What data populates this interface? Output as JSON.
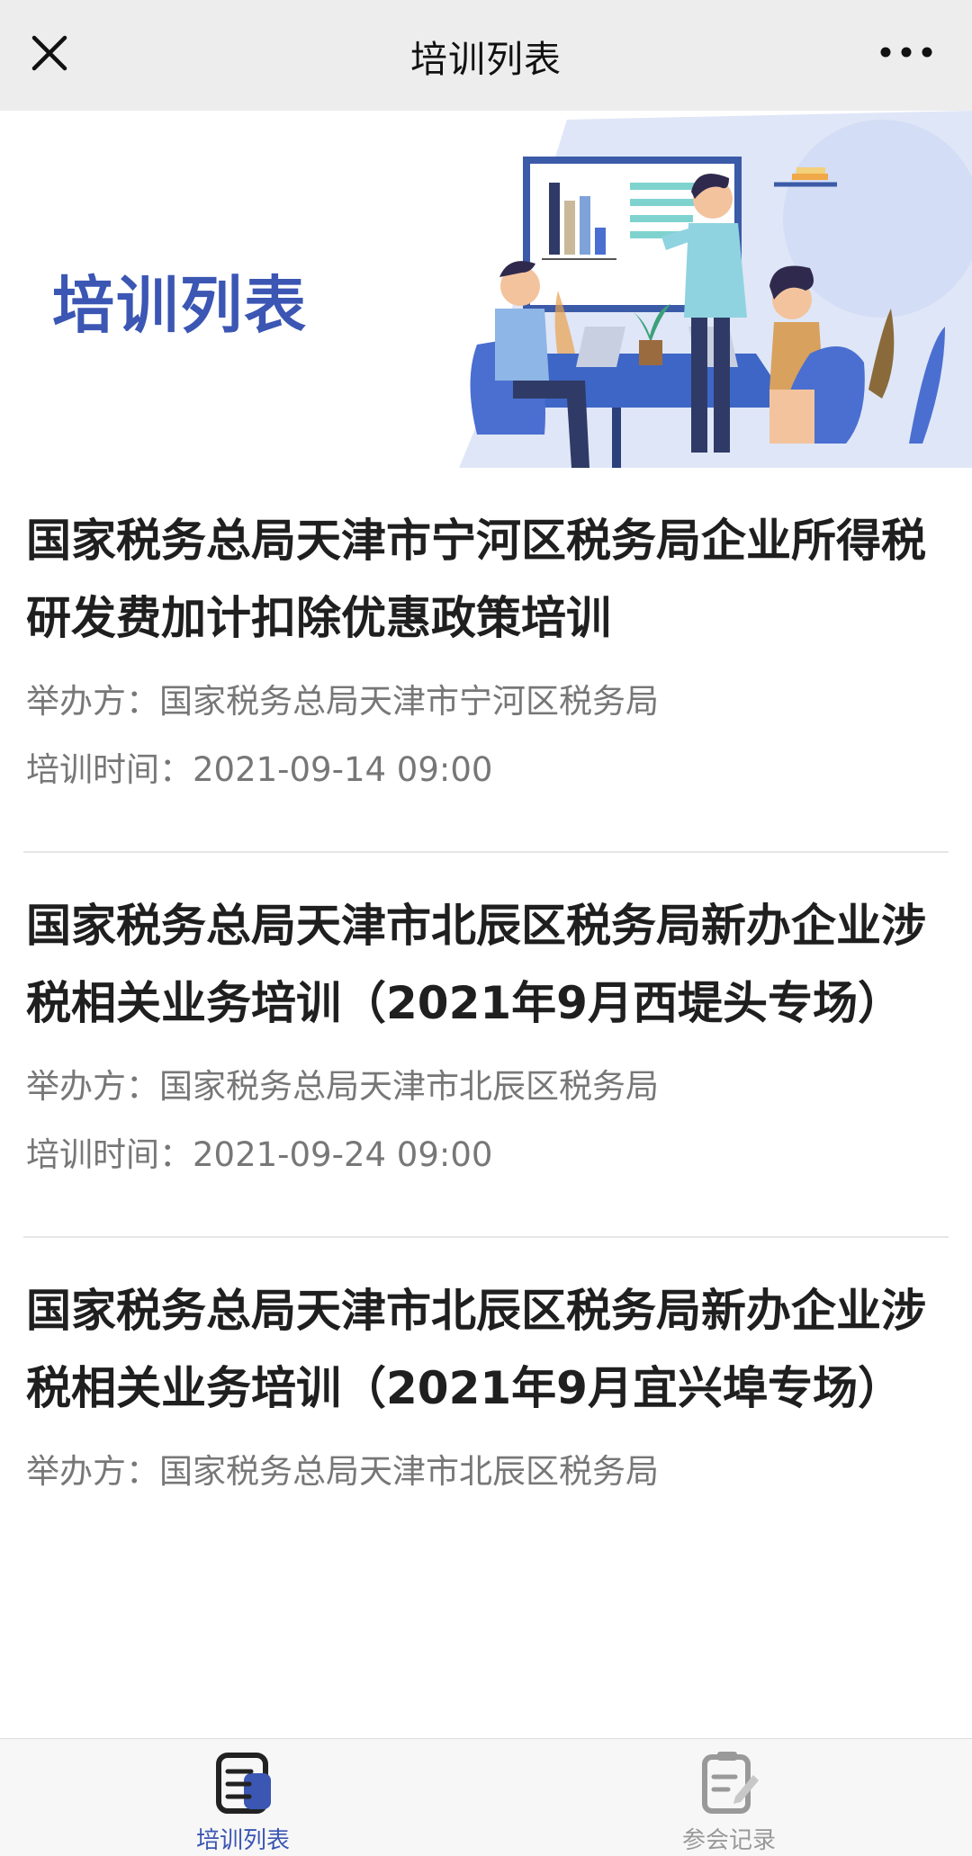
{
  "header": {
    "title": "培训列表"
  },
  "banner": {
    "title": "培训列表"
  },
  "trainings": [
    {
      "title": "国家税务总局天津市宁河区税务局企业所得税研发费加计扣除优惠政策培训",
      "organizer_label": "举办方：",
      "organizer": "国家税务总局天津市宁河区税务局",
      "time_label": "培训时间：",
      "time": "2021-09-14 09:00"
    },
    {
      "title": "国家税务总局天津市北辰区税务局新办企业涉税相关业务培训（2021年9月西堤头专场）",
      "organizer_label": "举办方：",
      "organizer": "国家税务总局天津市北辰区税务局",
      "time_label": "培训时间：",
      "time": "2021-09-24 09:00"
    },
    {
      "title": "国家税务总局天津市北辰区税务局新办企业涉税相关业务培训（2021年9月宜兴埠专场）",
      "organizer_label": "举办方：",
      "organizer": "国家税务总局天津市北辰区税务局"
    }
  ],
  "tabbar": {
    "tabs": [
      {
        "label": "培训列表",
        "icon": "training-list-icon",
        "active": true
      },
      {
        "label": "参会记录",
        "icon": "attendance-record-icon",
        "active": false
      }
    ]
  },
  "colors": {
    "accent": "#3b56b3",
    "topbar_bg": "#ededed"
  }
}
